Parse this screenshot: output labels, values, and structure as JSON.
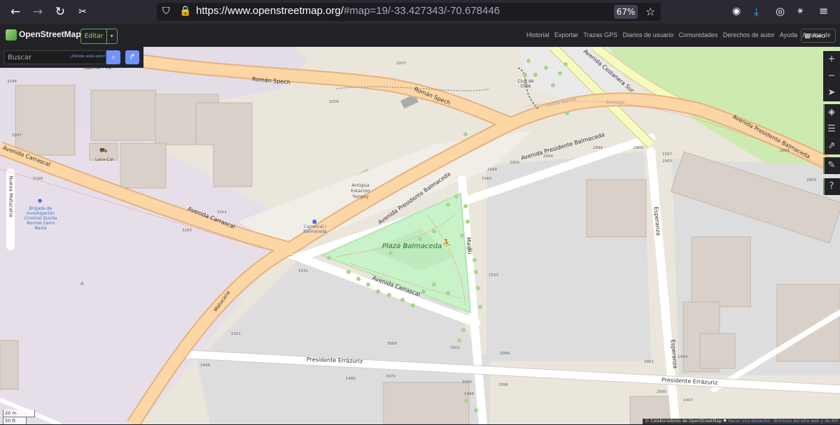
{
  "browser": {
    "url_main": "https://www.openstreetmap.org/",
    "url_rest": "#map=19/-33.427343/-70.678446",
    "zoom": "67%"
  },
  "osm": {
    "site_title": "OpenStreetMap",
    "edit_label": "Editar",
    "nav": [
      "Historial",
      "Exportar",
      "Trazas GPS",
      "Diarios de usuario",
      "Comunidades",
      "Derechos de autor",
      "Ayuda",
      "Acerca de"
    ],
    "user": "Awo",
    "search_placeholder": "Buscar",
    "where_is_this": "¿Dónde está esto?"
  },
  "map": {
    "streets": {
      "roman_spech_top": "Román Spech",
      "roman_spech": "Román Spech",
      "roman_spech_right": "Román Spech",
      "carrascal_left": "Avenida Carrascal",
      "carrascal_mid": "Avenida Carrascal",
      "carrascal_park": "Avenida Carrascal",
      "balmaceda_left": "Avenida Presidente Balmaceda",
      "balmaceda_top": "Avenida Presidente Balmaceda",
      "balmaceda_right": "Avenida Presidente Balmaceda",
      "costanera": "Avenida Costanera Sur",
      "maipu": "Maipú",
      "esperanza_top": "Esperanza",
      "esperanza_bottom": "Esperanza",
      "errazuriz_left": "Presidente Errázuriz",
      "errazuriz_right": "Presidente Errázuriz",
      "matucana": "Matucana",
      "nueva_matucana": "Nueva Matucana",
      "quinta_normal_rail": "Quinta Normal",
      "santiago_rail": "Santiago"
    },
    "pois": {
      "plaza": "Plaza Balmaceda",
      "cruz": "Cruz de Chile",
      "estacion": "Antigua Estación Yungay",
      "carrascal_stop": "Carrascal / Balmaceda",
      "lava_car": "Lava-Car",
      "brigada": "Brigada de Investigación Criminal Quinta Normal Cerro Navia"
    },
    "housenumbers": [
      "3207",
      "3206",
      "3298",
      "3297",
      "3298",
      "3201",
      "3200",
      "2994",
      "2900",
      "2994",
      "2900",
      "1597",
      "2898",
      "2800",
      "2994",
      "2900",
      "1583",
      "1531",
      "1523",
      "1501",
      "3069",
      "3001",
      "2999",
      "2901",
      "1499",
      "1499",
      "1482",
      "3070",
      "3000",
      "1498",
      "2998",
      "2899",
      "1497"
    ]
  },
  "scale": {
    "m": "20 m",
    "ft": "50 ft"
  },
  "attribution": {
    "text": "© Colaboradores de OpenStreetMap ♥",
    "donate": "Hacer una donación.",
    "terms": "Términos del sitio web y de API"
  }
}
